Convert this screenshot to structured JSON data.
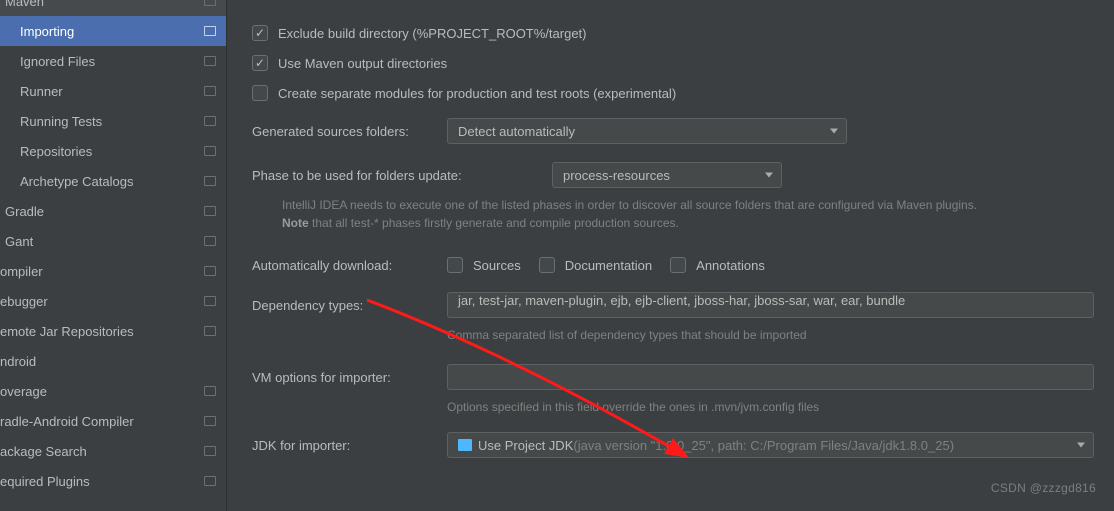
{
  "sidebar": {
    "items": [
      {
        "label": "Maven",
        "level": 1
      },
      {
        "label": "Importing",
        "level": 2,
        "selected": true
      },
      {
        "label": "Ignored Files",
        "level": 2
      },
      {
        "label": "Runner",
        "level": 2
      },
      {
        "label": "Running Tests",
        "level": 2
      },
      {
        "label": "Repositories",
        "level": 2
      },
      {
        "label": "Archetype Catalogs",
        "level": 2
      },
      {
        "label": "Gradle",
        "level": 1
      },
      {
        "label": "Gant",
        "level": 1
      },
      {
        "label": "ompiler",
        "level": 0
      },
      {
        "label": "ebugger",
        "level": 0
      },
      {
        "label": "emote Jar Repositories",
        "level": 0
      },
      {
        "label": "ndroid",
        "level": 0
      },
      {
        "label": "overage",
        "level": 0
      },
      {
        "label": "radle-Android Compiler",
        "level": 0
      },
      {
        "label": "ackage Search",
        "level": 0
      },
      {
        "label": "equired Plugins",
        "level": 0
      }
    ]
  },
  "checkboxes": {
    "exclude": "Exclude build directory (%PROJECT_ROOT%/target)",
    "usemaven": "Use Maven output directories",
    "separate": "Create separate modules for production and test roots (experimental)"
  },
  "form": {
    "gen_label": "Generated sources folders:",
    "gen_value": "Detect automatically",
    "phase_label": "Phase to be used for folders update:",
    "phase_value": "process-resources",
    "hint1a": "IntelliJ IDEA needs to execute one of the listed phases in order to discover all source folders that are configured via Maven plugins.",
    "hint1b_bold": "Note",
    "hint1b_rest": " that all test-* phases firstly generate and compile production sources.",
    "auto_label": "Automatically download:",
    "auto_sources": "Sources",
    "auto_doc": "Documentation",
    "auto_ann": "Annotations",
    "dep_label": "Dependency types:",
    "dep_value": "jar, test-jar, maven-plugin, ejb, ejb-client, jboss-har, jboss-sar, war, ear, bundle",
    "dep_hint": "Comma separated list of dependency types that should be imported",
    "vm_label": "VM options for importer:",
    "vm_value": "",
    "vm_hint": "Options specified in this field override the ones in .mvn/jvm.config files",
    "jdk_label": "JDK for importer:",
    "jdk_value": "Use Project JDK ",
    "jdk_grey": "(java version \"1.8.0_25\", path: C:/Program Files/Java/jdk1.8.0_25)"
  },
  "watermark": "CSDN @zzzgd816"
}
